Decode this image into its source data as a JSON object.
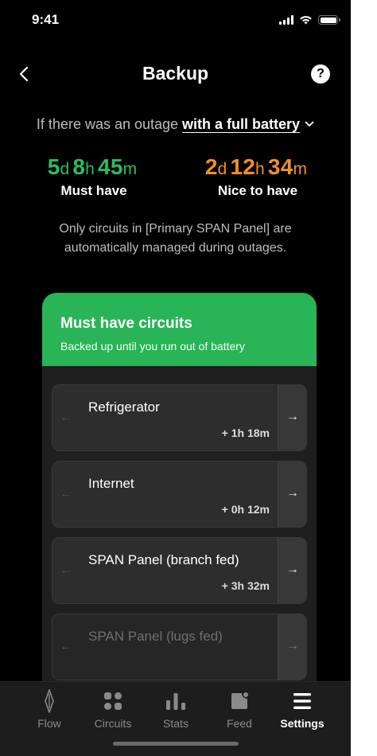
{
  "status_bar": {
    "time": "9:41"
  },
  "header": {
    "title": "Backup",
    "help_label": "?"
  },
  "outage": {
    "prefix": "If there was an outage ",
    "selected": "with a full battery"
  },
  "durations": {
    "must": {
      "d": "5",
      "h": "8",
      "m": "45",
      "label": "Must have"
    },
    "nice": {
      "d": "2",
      "h": "12",
      "m": "34",
      "label": "Nice to have"
    },
    "units": {
      "d": "d",
      "h": "h",
      "m": "m"
    }
  },
  "info": {
    "text": "Only circuits in [Primary SPAN Panel] are automatically managed during outages."
  },
  "card": {
    "title": "Must have circuits",
    "subtitle": "Backed up until you run out of battery",
    "circuits": [
      {
        "name": "Refrigerator",
        "gain": "+ 1h 18m"
      },
      {
        "name": "Internet",
        "gain": "+ 0h 12m"
      },
      {
        "name": "SPAN Panel (branch fed)",
        "gain": "+ 3h 32m"
      },
      {
        "name": "SPAN Panel (lugs fed)",
        "gain": ""
      }
    ],
    "arrow_left": "←",
    "arrow_right": "→"
  },
  "tabs": [
    {
      "label": "Flow",
      "icon": "flow-icon"
    },
    {
      "label": "Circuits",
      "icon": "circuits-icon"
    },
    {
      "label": "Stats",
      "icon": "stats-icon"
    },
    {
      "label": "Feed",
      "icon": "feed-icon"
    },
    {
      "label": "Settings",
      "icon": "settings-icon",
      "active": true
    }
  ],
  "colors": {
    "must": "#2bbd61",
    "nice": "#f0902a",
    "card_header": "#28b457",
    "background": "#000000"
  }
}
